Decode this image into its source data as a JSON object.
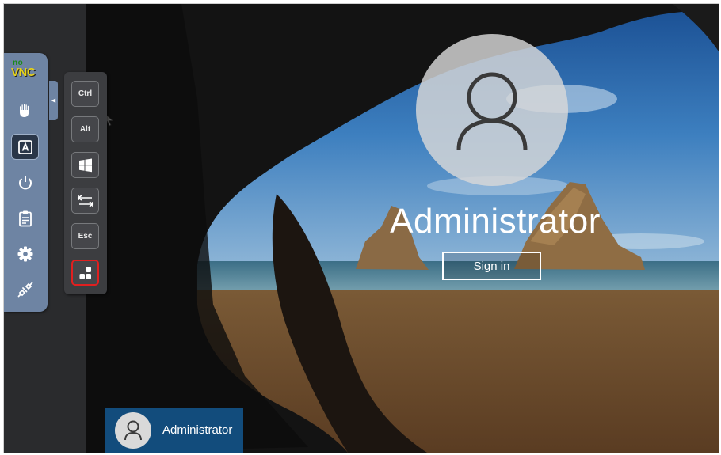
{
  "app": {
    "logo_no": "no",
    "logo_vnc": "VNC"
  },
  "control_bar": {
    "buttons": [
      {
        "icon": "drag-hand-icon"
      },
      {
        "icon": "keyboard-a-icon",
        "selected": true
      },
      {
        "icon": "power-icon"
      },
      {
        "icon": "clipboard-icon"
      },
      {
        "icon": "gear-icon"
      },
      {
        "icon": "disconnect-icon"
      }
    ],
    "handle_glyph": "◀"
  },
  "extra_keys": {
    "ctrl": "Ctrl",
    "alt": "Alt",
    "windows_icon": "windows-logo-icon",
    "tab_icon": "tab-arrows-icon",
    "esc": "Esc",
    "ctrl_alt_del_icon": "ctrl-alt-del-icon"
  },
  "login": {
    "username": "Administrator",
    "signin_label": "Sign in",
    "tile_username": "Administrator"
  },
  "colors": {
    "control_bar": "#6e84a3",
    "highlight_border": "#e11f1f",
    "user_tile": "#124c7c"
  }
}
